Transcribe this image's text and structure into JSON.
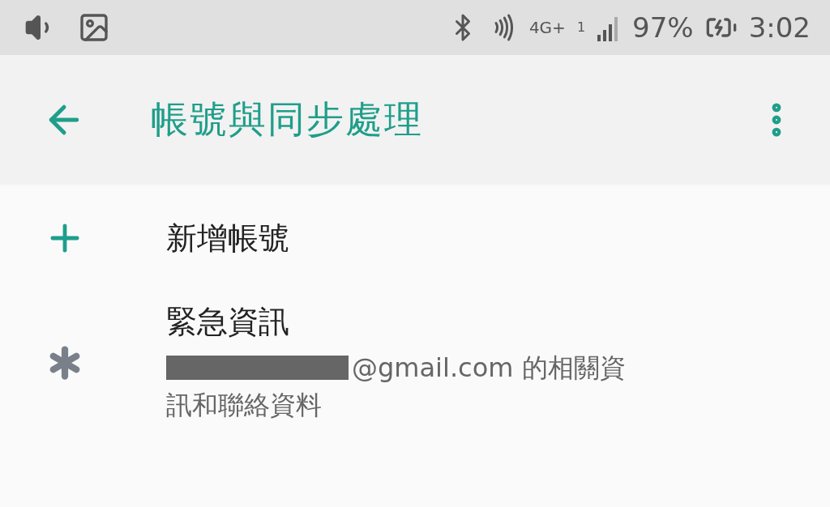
{
  "status_bar": {
    "network": "4G+",
    "sim": "1",
    "battery": "97%",
    "time": "3:02"
  },
  "toolbar": {
    "title": "帳號與同步處理"
  },
  "items": [
    {
      "kind": "add",
      "title": "新增帳號"
    },
    {
      "kind": "info",
      "title": "緊急資訊",
      "subtitle": "@gmail.com  的相關資訊和聯絡資料",
      "redacted": true
    }
  ]
}
